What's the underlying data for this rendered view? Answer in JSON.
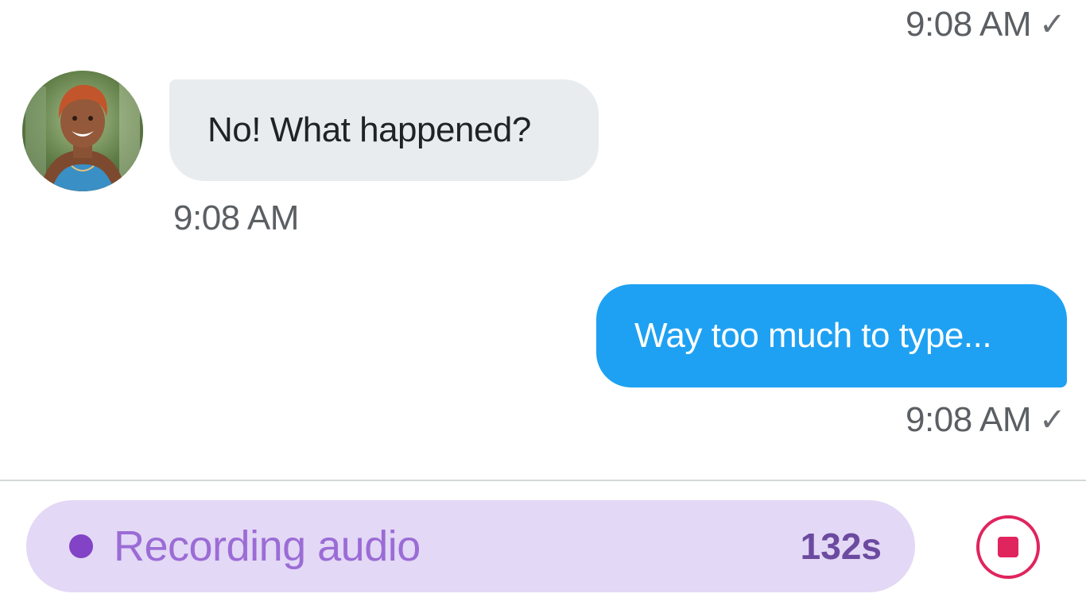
{
  "messages": [
    {
      "direction": "outgoing",
      "text": "",
      "timestamp": "9:08 AM",
      "status_icon": "checkmark-icon",
      "status_glyph": "✓"
    },
    {
      "direction": "incoming",
      "text": "No! What happened?",
      "timestamp": "9:08 AM",
      "avatar_icon": "contact-avatar"
    },
    {
      "direction": "outgoing",
      "text": "Way too much to type...",
      "timestamp": "9:08 AM",
      "status_icon": "checkmark-icon",
      "status_glyph": "✓"
    }
  ],
  "recorder": {
    "status_label": "Recording audio",
    "elapsed": "132s",
    "indicator_icon": "recording-dot-icon",
    "stop_icon": "stop-icon"
  },
  "colors": {
    "incoming_bubble": "#e9ecef",
    "outgoing_bubble": "#1ea1f2",
    "recorder_background": "#e3d8f5",
    "recording_accent": "#8243c7",
    "stop_accent": "#e0245e"
  }
}
